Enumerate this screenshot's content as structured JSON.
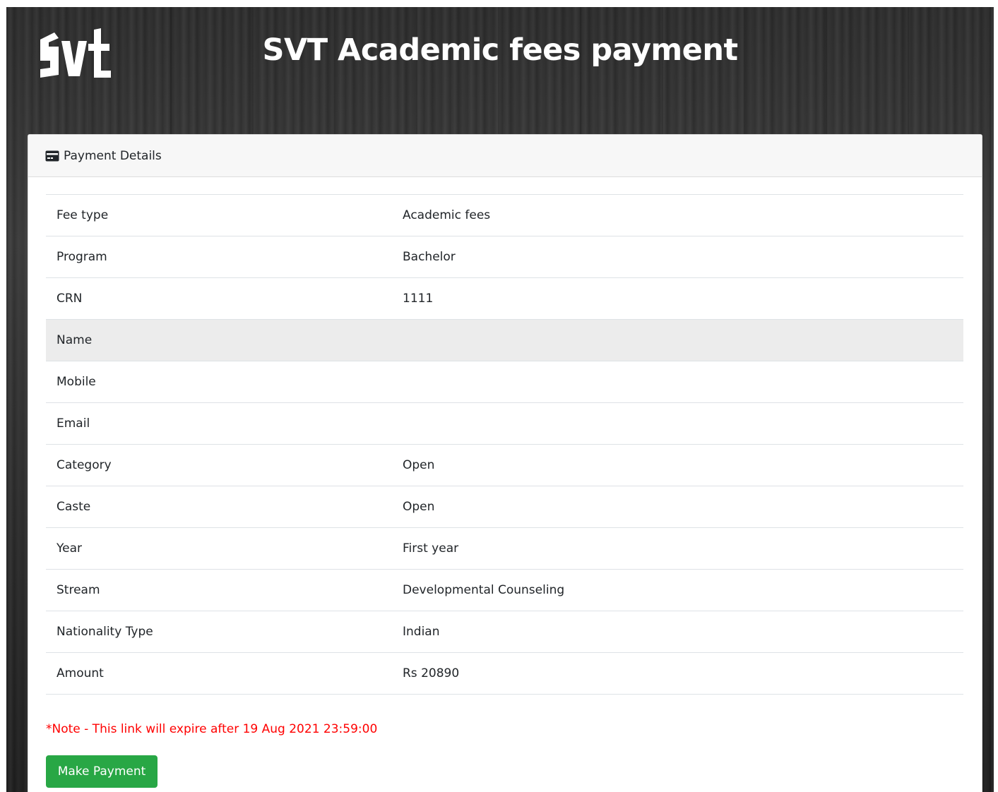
{
  "header": {
    "logo_text": "SVT",
    "title": "SVT Academic fees payment"
  },
  "card": {
    "icon": "credit-card-icon",
    "title": "Payment Details"
  },
  "details": [
    {
      "label": "Fee type",
      "value": "Academic fees"
    },
    {
      "label": "Program",
      "value": "Bachelor"
    },
    {
      "label": "CRN",
      "value": "1111"
    },
    {
      "label": "Name",
      "value": ""
    },
    {
      "label": "Mobile",
      "value": ""
    },
    {
      "label": "Email",
      "value": ""
    },
    {
      "label": "Category",
      "value": "Open"
    },
    {
      "label": "Caste",
      "value": "Open"
    },
    {
      "label": "Year",
      "value": "First year"
    },
    {
      "label": "Stream",
      "value": "Developmental Counseling"
    },
    {
      "label": "Nationality Type",
      "value": "Indian"
    },
    {
      "label": "Amount",
      "value": "Rs 20890"
    }
  ],
  "note": "*Note - This link will expire after 19 Aug 2021 23:59:00",
  "payment_button": "Make Payment",
  "colors": {
    "note": "#ff0000",
    "button": "#28a745",
    "highlight_row": "#ececec"
  }
}
